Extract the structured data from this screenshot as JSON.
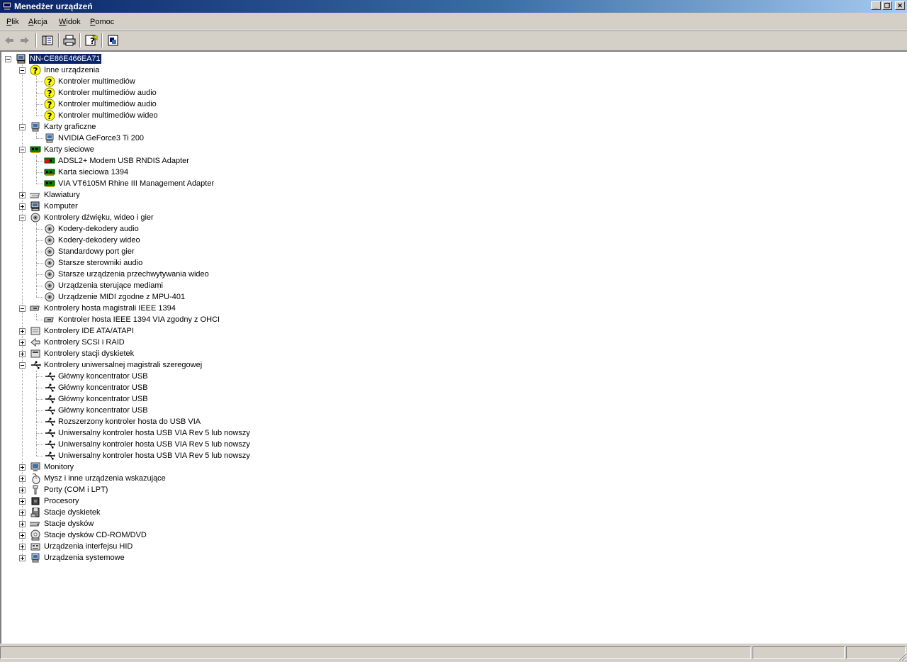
{
  "window": {
    "title": "Menedżer urządzeń"
  },
  "menu": [
    "Plik",
    "Akcja",
    "Widok",
    "Pomoc"
  ],
  "toolbar": [
    "back-icon",
    "forward-icon",
    "show-hide-console-tree-icon",
    "print-icon",
    "help-icon",
    "properties-icon"
  ],
  "tree": {
    "root": {
      "label": "NN-CE86E466EA71",
      "icon": "computer-icon"
    },
    "categories": [
      {
        "label": "Inne urządzenia",
        "icon": "unknown-device-icon",
        "expanded": true,
        "children": [
          "Kontroler multimediów",
          "Kontroler multimediów audio",
          "Kontroler multimediów audio",
          "Kontroler multimediów wideo"
        ]
      },
      {
        "label": "Karty graficzne",
        "icon": "display-adapter-icon",
        "expanded": true,
        "children": [
          "NVIDIA GeForce3 Ti 200"
        ]
      },
      {
        "label": "Karty sieciowe",
        "icon": "network-card-icon",
        "expanded": true,
        "children": [
          "ADSL2+ Modem USB RNDIS Adapter",
          "Karta sieciowa 1394",
          "VIA VT6105M Rhine III Management Adapter"
        ]
      },
      {
        "label": "Klawiatury",
        "icon": "keyboard-icon",
        "expanded": false,
        "children": []
      },
      {
        "label": "Komputer",
        "icon": "computer-icon",
        "expanded": false,
        "children": []
      },
      {
        "label": "Kontrolery dźwięku, wideo i gier",
        "icon": "sound-icon",
        "expanded": true,
        "children": [
          "Kodery-dekodery audio",
          "Kodery-dekodery wideo",
          "Standardowy port gier",
          "Starsze sterowniki audio",
          "Starsze urządzenia przechwytywania wideo",
          "Urządzenia sterujące mediami",
          "Urządzenie MIDI zgodne z MPU-401"
        ]
      },
      {
        "label": "Kontrolery hosta magistrali IEEE 1394",
        "icon": "ieee1394-icon",
        "expanded": true,
        "children": [
          "Kontroler hosta IEEE 1394 VIA zgodny z OHCI"
        ]
      },
      {
        "label": "Kontrolery IDE ATA/ATAPI",
        "icon": "ide-controller-icon",
        "expanded": false,
        "children": []
      },
      {
        "label": "Kontrolery SCSI i RAID",
        "icon": "scsi-icon",
        "expanded": false,
        "children": []
      },
      {
        "label": "Kontrolery stacji dyskietek",
        "icon": "floppy-controller-icon",
        "expanded": false,
        "children": []
      },
      {
        "label": "Kontrolery uniwersalnej magistrali szeregowej",
        "icon": "usb-icon",
        "expanded": true,
        "children": [
          "Główny koncentrator USB",
          "Główny koncentrator USB",
          "Główny koncentrator USB",
          "Główny koncentrator USB",
          "Rozszerzony kontroler hosta do USB VIA",
          "Uniwersalny kontroler hosta USB VIA Rev 5 lub nowszy",
          "Uniwersalny kontroler hosta USB VIA Rev 5 lub nowszy",
          "Uniwersalny kontroler hosta USB VIA Rev 5 lub nowszy"
        ]
      },
      {
        "label": "Monitory",
        "icon": "monitor-icon",
        "expanded": false,
        "children": []
      },
      {
        "label": "Mysz i inne urządzenia wskazujące",
        "icon": "mouse-icon",
        "expanded": false,
        "children": []
      },
      {
        "label": "Porty (COM i LPT)",
        "icon": "port-icon",
        "expanded": false,
        "children": []
      },
      {
        "label": "Procesory",
        "icon": "processor-icon",
        "expanded": false,
        "children": []
      },
      {
        "label": "Stacje dyskietek",
        "icon": "floppy-drive-icon",
        "expanded": false,
        "children": []
      },
      {
        "label": "Stacje dysków",
        "icon": "disk-drive-icon",
        "expanded": false,
        "children": []
      },
      {
        "label": "Stacje dysków CD-ROM/DVD",
        "icon": "cdrom-icon",
        "expanded": false,
        "children": []
      },
      {
        "label": "Urządzenia interfejsu HID",
        "icon": "hid-icon",
        "expanded": false,
        "children": []
      },
      {
        "label": "Urządzenia systemowe",
        "icon": "system-device-icon",
        "expanded": false,
        "children": []
      }
    ]
  },
  "colors": {
    "selection": "#0a246a",
    "title_start": "#0a246a",
    "title_end": "#a6caf0",
    "face": "#d4d0c8"
  }
}
